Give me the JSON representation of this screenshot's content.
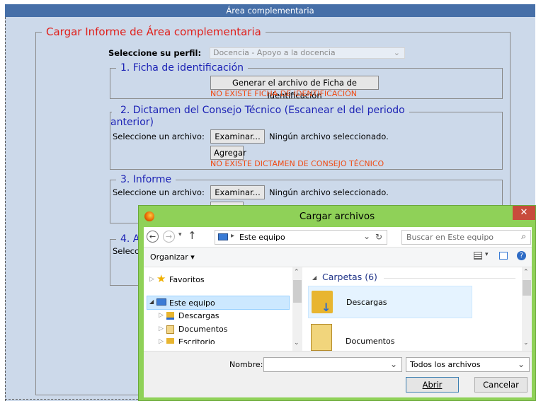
{
  "window": {
    "title": "Área complementaria"
  },
  "form": {
    "legend": "Cargar Informe de Área complementaria",
    "profile_label": "Seleccione su perfil:",
    "profile_value": "Docencia - Apoyo a la docencia",
    "sections": {
      "s1": {
        "legend": "1. Ficha de identificación",
        "button": "Generar el archivo de Ficha de Identificación",
        "error": "NO EXISTE FICHA DE IDENTIFICACIÓN"
      },
      "s2": {
        "legend_line1": "2. Dictamen del Consejo Técnico (Escanear el del periodo",
        "legend_line2": "anterior)",
        "file_label": "Seleccione un archivo:",
        "browse": "Examinar...",
        "no_file": "Ningún archivo seleccionado.",
        "add": "Agregar",
        "error": "NO EXISTE DICTAMEN DE CONSEJO TÉCNICO"
      },
      "s3": {
        "legend": "3. Informe",
        "file_label": "Seleccione un archivo:",
        "browse": "Examinar...",
        "no_file": "Ningún archivo seleccionado."
      },
      "s4": {
        "legend": "4. A",
        "file_label": "Selecci"
      }
    }
  },
  "dialog": {
    "title": "Cargar archivos",
    "close": "✕",
    "address": "Este equipo",
    "search_placeholder": "Buscar en Este equipo",
    "organize": "Organizar ▾",
    "tree": {
      "favorites": "Favoritos",
      "this_pc": "Este equipo",
      "downloads": "Descargas",
      "documents": "Documentos",
      "partial": "Escritorio"
    },
    "group": "Carpetas (6)",
    "folders": {
      "downloads": "Descargas",
      "documents": "Documentos"
    },
    "filename_label": "Nombre:",
    "filetype": "Todos los archivos",
    "open": "Abrir",
    "cancel": "Cancelar"
  }
}
